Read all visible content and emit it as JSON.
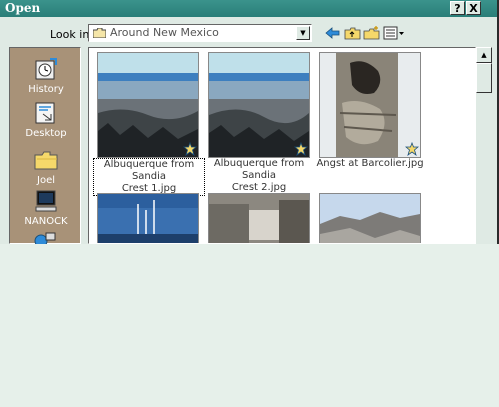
{
  "window": {
    "title": "Open",
    "help_button": "?",
    "close_button": "X"
  },
  "lookin": {
    "label": "Look in:",
    "value": "Around New Mexico"
  },
  "toolbar": {
    "icons": [
      "back-arrow-icon",
      "up-folder-icon",
      "new-folder-icon",
      "views-menu-icon"
    ]
  },
  "places": [
    {
      "label": "History",
      "icon": "history-icon"
    },
    {
      "label": "Desktop",
      "icon": "desktop-icon"
    },
    {
      "label": "Joel",
      "icon": "folder-icon"
    },
    {
      "label": "NANOCK",
      "icon": "computer-icon"
    }
  ],
  "files": [
    {
      "name_line1": "Albuquerque from Sandia",
      "name_line2": "Crest 1.jpg",
      "selected": true
    },
    {
      "name_line1": "Albuquerque from Sandia",
      "name_line2": "Crest 2.jpg",
      "selected": false
    },
    {
      "name_line1": "Angst at Barcolier.jpg",
      "name_line2": "",
      "selected": false
    }
  ],
  "colors": {
    "titlebar": "#2a7e78",
    "places_bar": "#a89278",
    "dialog_face": "#dfeae4"
  }
}
